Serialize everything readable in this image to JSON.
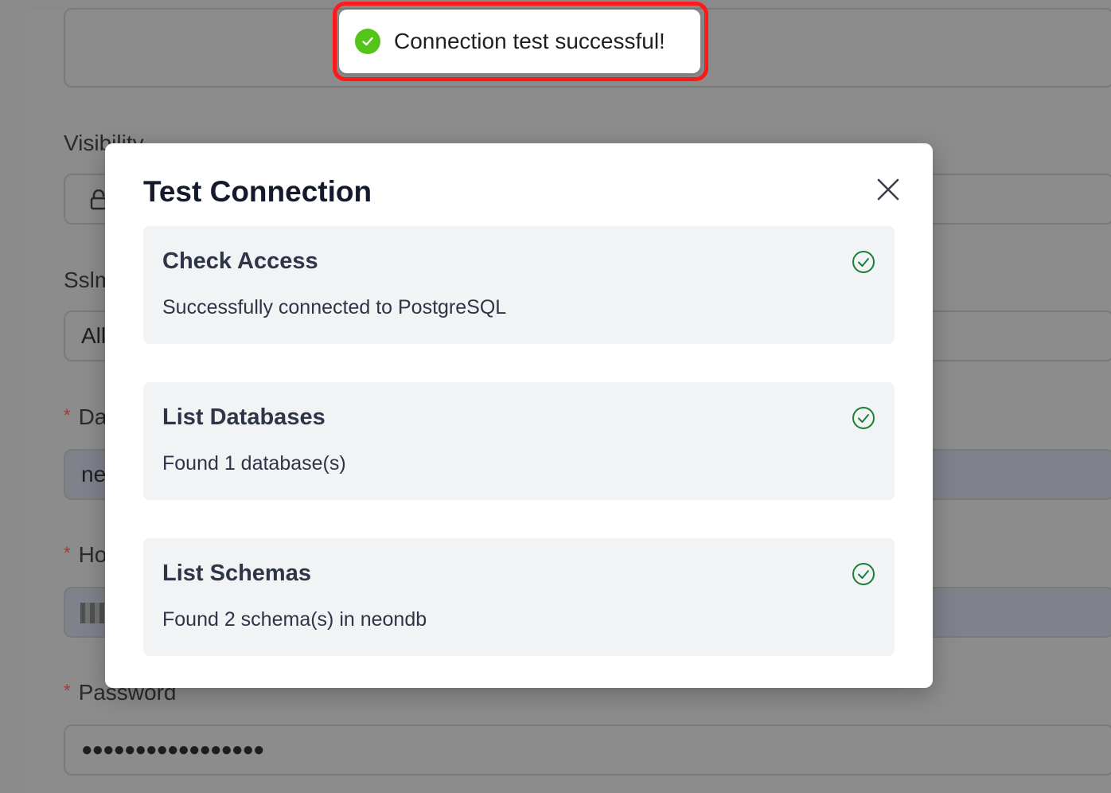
{
  "background_form": {
    "visibility_label": "Visibility",
    "sslmode_label": "Sslmode",
    "sslmode_value": "All",
    "database_label": "Database",
    "database_value": "ne",
    "host_label": "Host",
    "password_label": "Password",
    "password_value": "●●●●●●●●●●●●●●●●●",
    "required_marker": "*"
  },
  "toast": {
    "message": "Connection test successful!",
    "icon": "check-circle-icon",
    "color": "#52c41a",
    "highlight_color": "#ff1a1a"
  },
  "modal": {
    "title": "Test Connection",
    "close_icon": "close-icon",
    "steps": [
      {
        "title": "Check Access",
        "description": "Successfully connected to PostgreSQL",
        "status_icon": "check-circle-outline-icon"
      },
      {
        "title": "List Databases",
        "description": "Found 1 database(s)",
        "status_icon": "check-circle-outline-icon"
      },
      {
        "title": "List Schemas",
        "description": "Found 2 schema(s) in neondb",
        "status_icon": "check-circle-outline-icon"
      }
    ],
    "success_color": "#1a7f37"
  }
}
